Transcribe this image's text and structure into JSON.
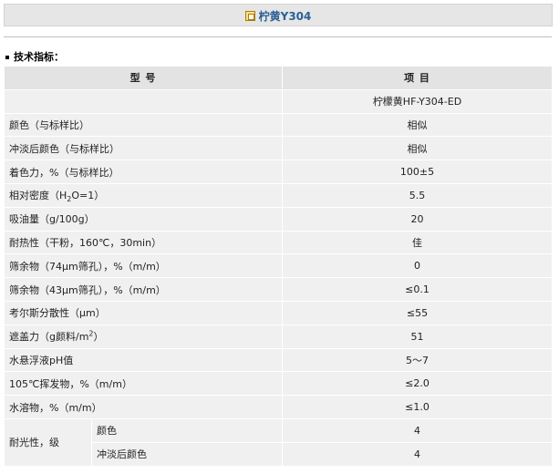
{
  "title": "柠黄Y304",
  "section_title": "技术指标：",
  "table": {
    "header": {
      "col1": "型  号",
      "col2": "项  目"
    },
    "product_row": "柠檬黄HF-Y304-ED",
    "rows": [
      {
        "label": "颜色（与标样比）",
        "value": "相似"
      },
      {
        "label": "冲淡后颜色（与标样比）",
        "value": "相似"
      },
      {
        "label": "着色力，%（与标样比）",
        "value": "100±5"
      },
      {
        "label_pre": "相对密度（H",
        "label_sub": "2",
        "label_post": "O=1）",
        "value": "5.5"
      },
      {
        "label": "吸油量（g/100g）",
        "value": "20"
      },
      {
        "label": "耐热性（干粉，160℃，30min）",
        "value": "佳"
      },
      {
        "label": "筛余物（74μm筛孔），%（m/m）",
        "value": "0"
      },
      {
        "label": "筛余物（43μm筛孔），%（m/m）",
        "value": "≤0.1"
      },
      {
        "label": "考尔斯分散性（μm）",
        "value": "≤55"
      },
      {
        "label_pre": "遮盖力（g颜料/m",
        "label_sup": "2",
        "label_post": "）",
        "value": "51"
      },
      {
        "label": "水悬浮液pH值",
        "value": "5～7"
      },
      {
        "label": "105℃挥发物，%（m/m）",
        "value": "≤2.0"
      },
      {
        "label": "水溶物，%（m/m）",
        "value": "≤1.0"
      }
    ],
    "lightfastness": {
      "label": "耐光性，级",
      "sub_rows": [
        {
          "label": "颜色",
          "value": "4"
        },
        {
          "label": "冲淡后颜色",
          "value": "4"
        }
      ]
    }
  }
}
